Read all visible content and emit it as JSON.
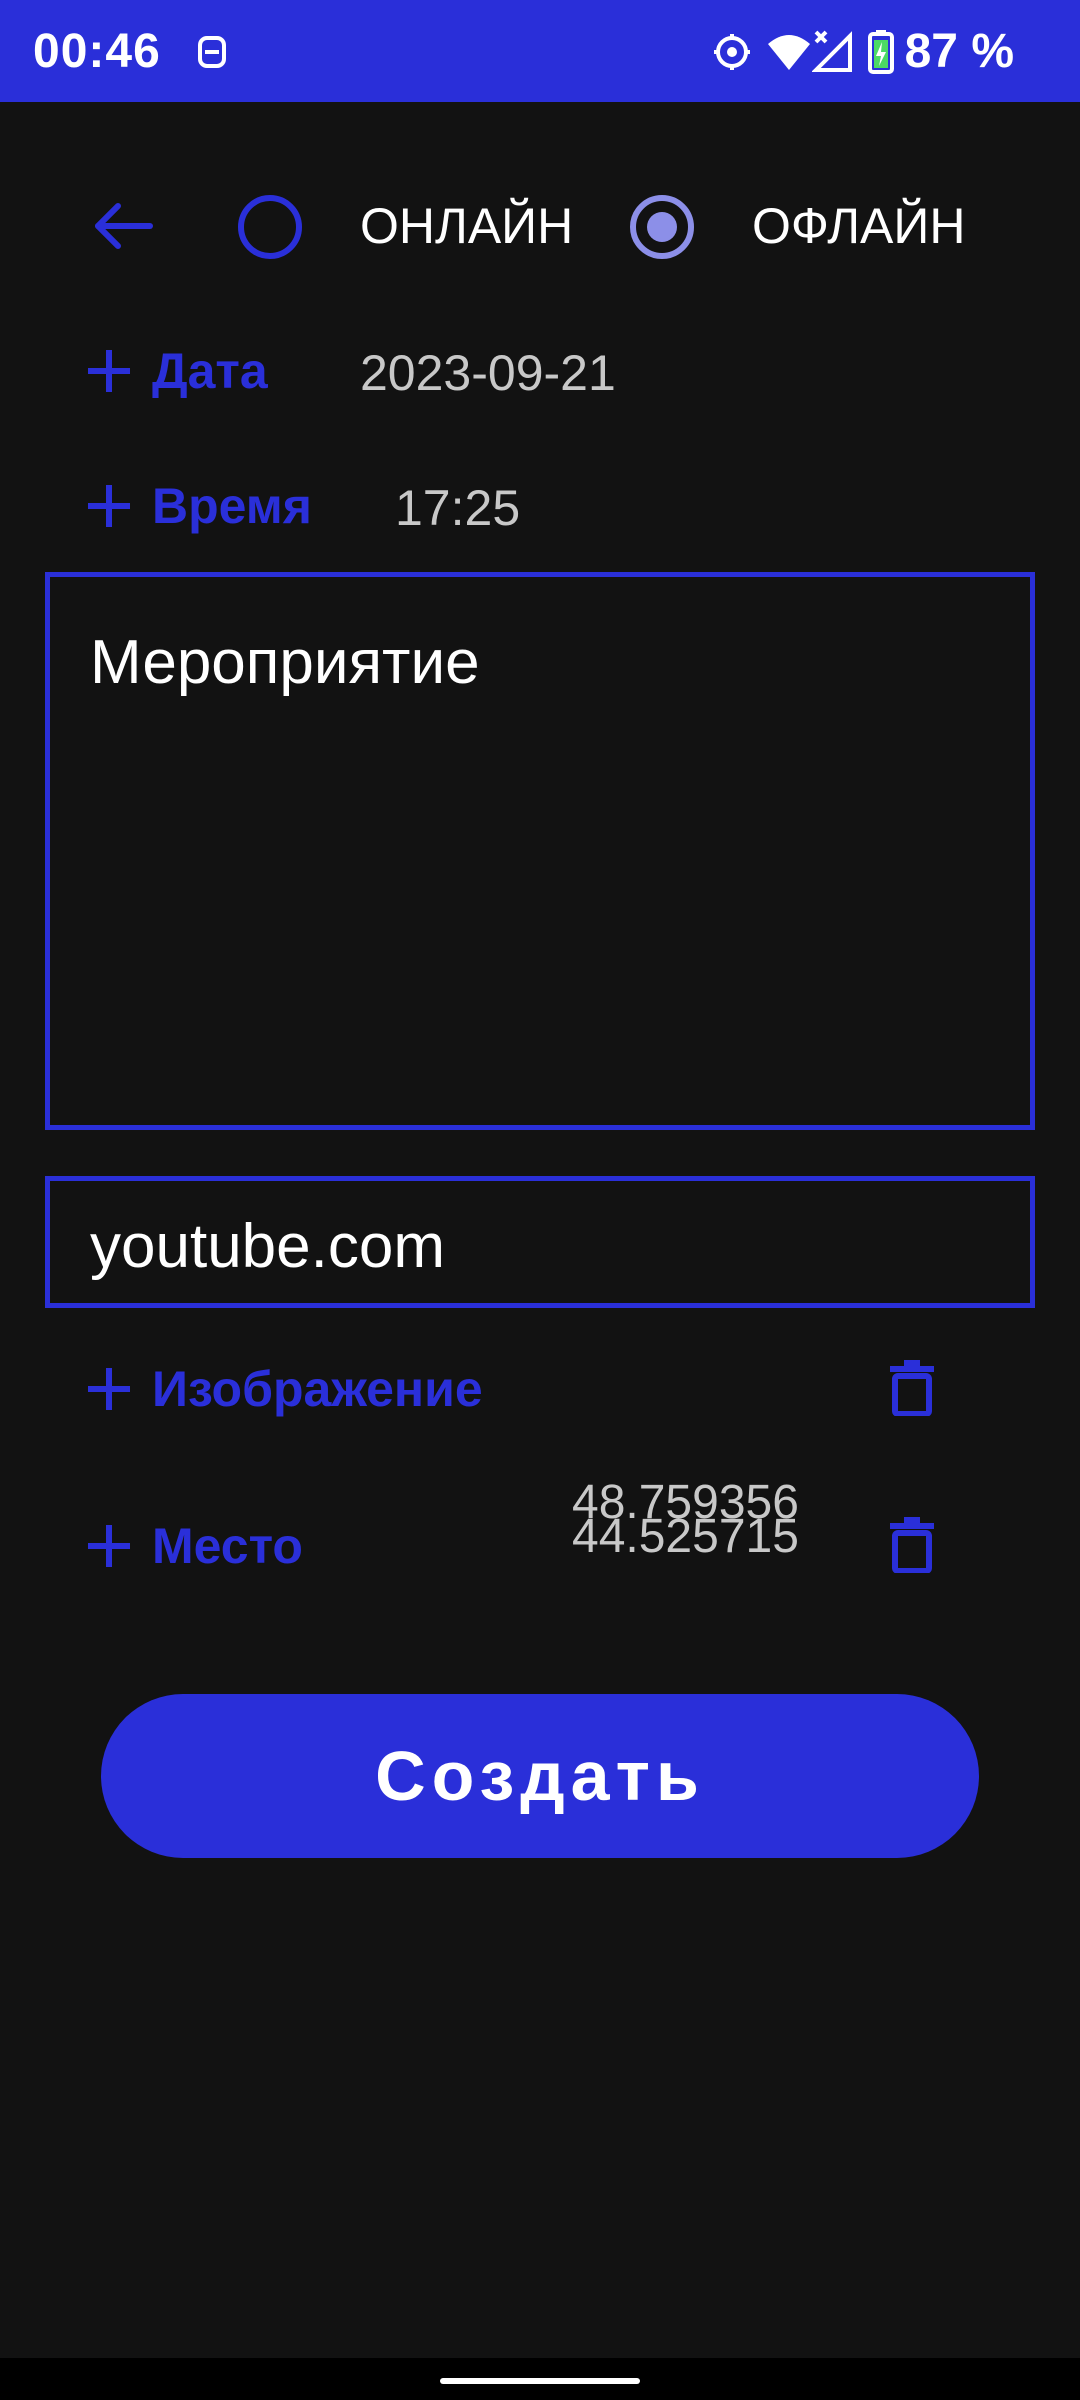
{
  "status_bar": {
    "time": "00:46",
    "battery": "87 %",
    "icons": [
      "notification-app-icon",
      "location-icon",
      "wifi-icon",
      "cellular-no-signal-icon",
      "battery-charging-icon"
    ]
  },
  "mode_toggle": {
    "online_label": "ОНЛАЙН",
    "offline_label": "ОФЛАЙН",
    "selected": "offline"
  },
  "date_row": {
    "label": "Дата",
    "value": "2023-09-21"
  },
  "time_row": {
    "label": "Время",
    "value": "17:25"
  },
  "title_field": {
    "value": "Мероприятие"
  },
  "link_field": {
    "value": "youtube.com"
  },
  "image_row": {
    "label": "Изображение"
  },
  "place_row": {
    "label": "Место",
    "latitude": "48.759356",
    "longitude": "44.525715"
  },
  "create_button": {
    "label": "Создать"
  },
  "colors": {
    "accent": "#2a2fd9",
    "background": "#121212",
    "radio_selected": "#8c8fe8",
    "value_text": "#c8c8c8"
  }
}
